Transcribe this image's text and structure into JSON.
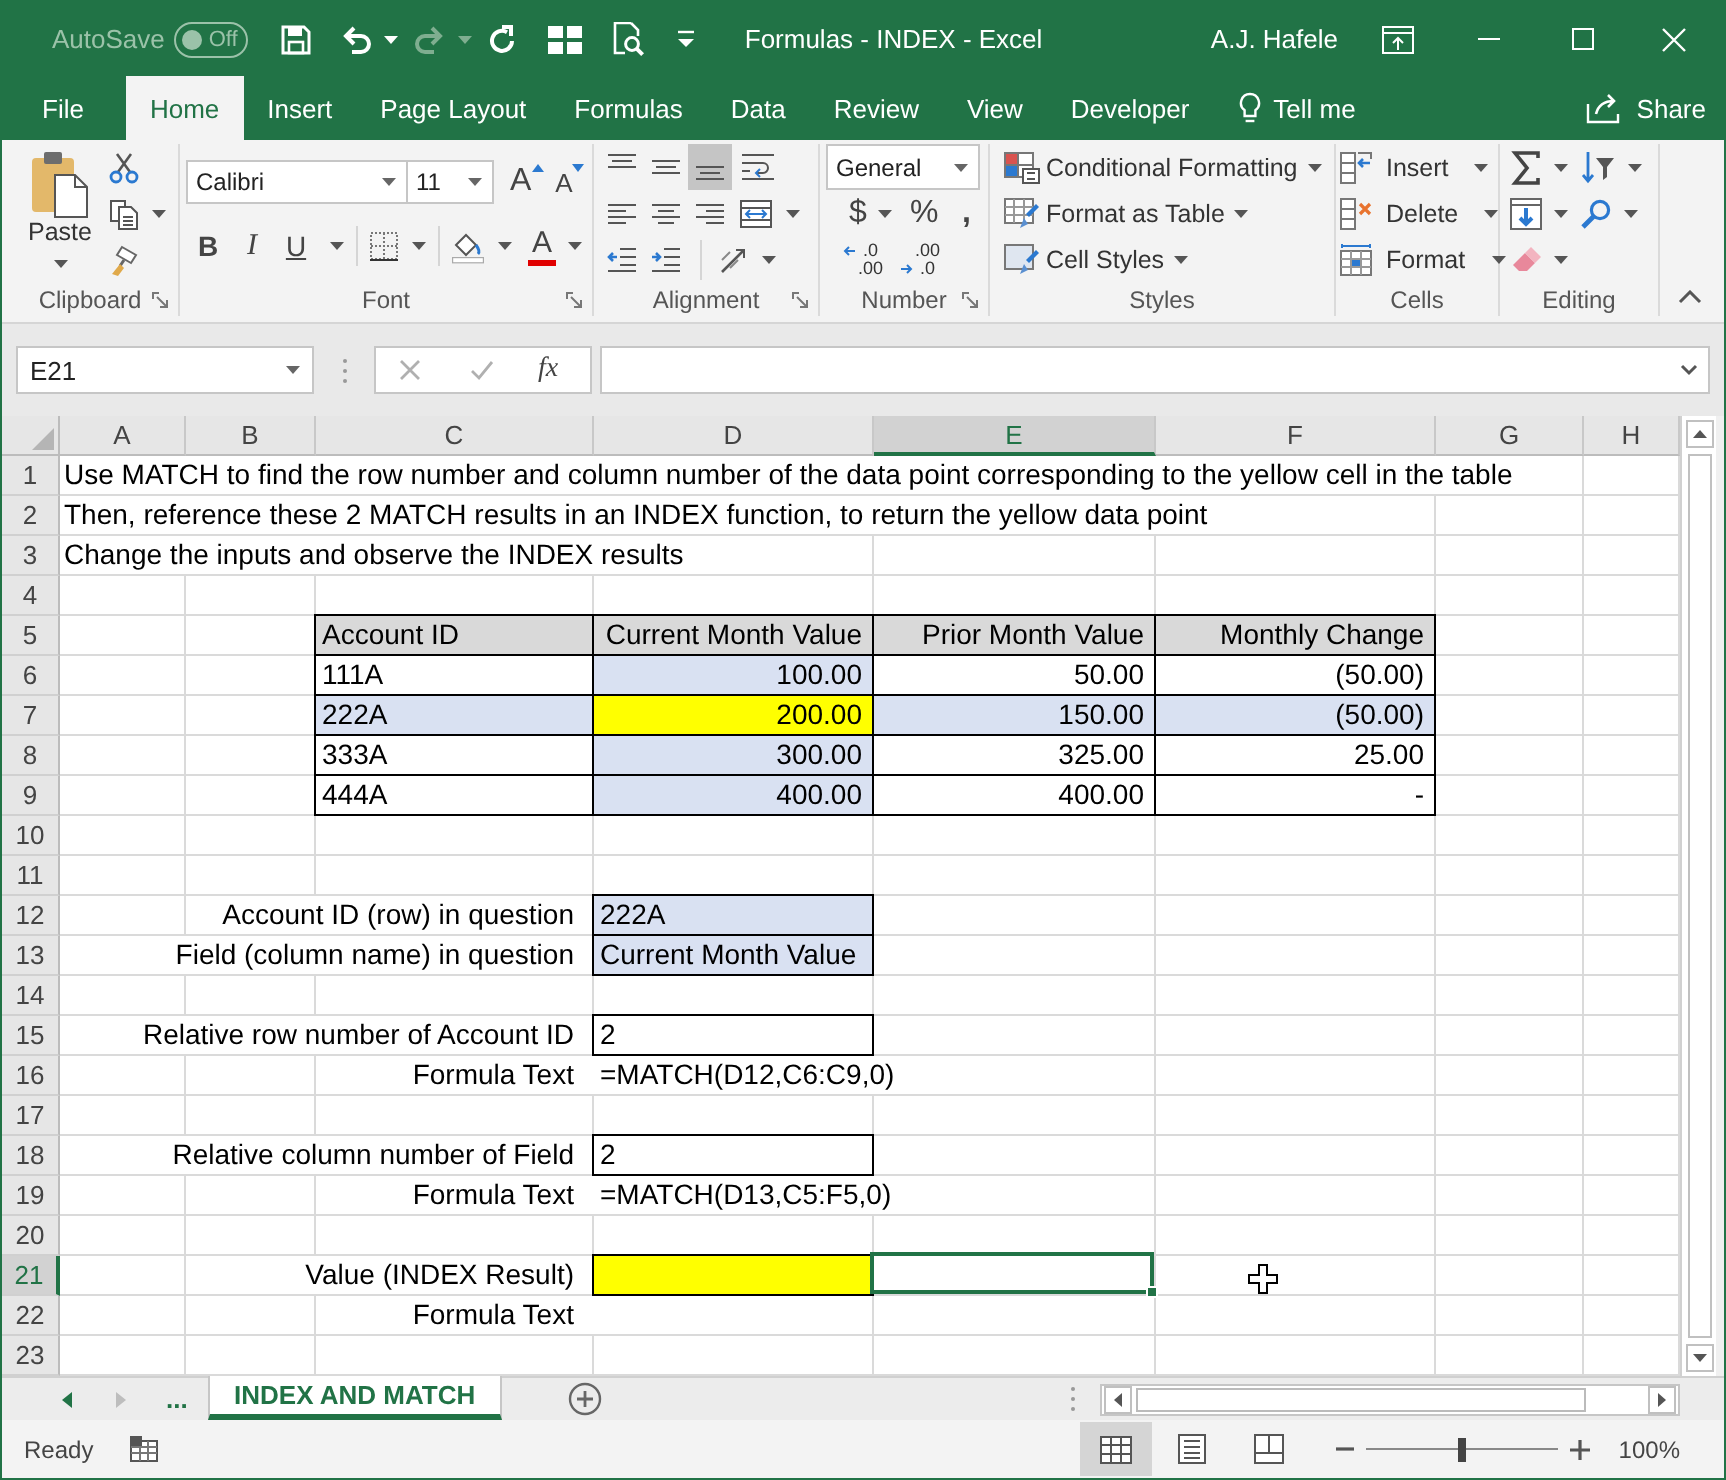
{
  "window": {
    "title": "Formulas - INDEX - Excel",
    "user": "A.J. Hafele",
    "autosave": {
      "label": "AutoSave",
      "on": false,
      "state": "Off"
    },
    "quick_access": [
      {
        "kind": "save",
        "disabled": false
      },
      {
        "kind": "undo",
        "disabled": false
      },
      {
        "kind": "redo",
        "disabled": true
      },
      {
        "kind": "refresh",
        "disabled": false
      },
      {
        "kind": "form",
        "disabled": false
      },
      {
        "kind": "print-preview",
        "disabled": false
      },
      {
        "kind": "customize",
        "disabled": false
      }
    ]
  },
  "menu_tabs": [
    {
      "label": "File",
      "selected": false
    },
    {
      "label": "Home",
      "selected": true
    },
    {
      "label": "Insert",
      "selected": false
    },
    {
      "label": "Page Layout",
      "selected": false
    },
    {
      "label": "Formulas",
      "selected": false
    },
    {
      "label": "Data",
      "selected": false
    },
    {
      "label": "Review",
      "selected": false
    },
    {
      "label": "View",
      "selected": false
    },
    {
      "label": "Developer",
      "selected": false
    }
  ],
  "tell_me": "Tell me",
  "share": "Share",
  "ribbon": {
    "groups": [
      {
        "kind": "clipboard",
        "label": "Clipboard",
        "paste": "Paste"
      },
      {
        "kind": "font",
        "label": "Font",
        "font_name": "Calibri",
        "font_size": "11",
        "grow": "A",
        "shrink": "A",
        "bold": "B",
        "italic": "I",
        "underline": "U",
        "font_color": "A"
      },
      {
        "kind": "alignment",
        "label": "Alignment",
        "vertical": [
          {
            "kind": "top",
            "selected": false
          },
          {
            "kind": "middle",
            "selected": false
          },
          {
            "kind": "bottom",
            "selected": true
          }
        ]
      },
      {
        "kind": "number",
        "label": "Number",
        "format": "General",
        "currency": "$",
        "percent": "%",
        "comma": ",",
        "decimals": [
          {
            "kind": "increase",
            "top": ".0",
            "bottom": ".00"
          },
          {
            "kind": "decrease",
            "top": ".00",
            "bottom": ".0"
          }
        ]
      },
      {
        "kind": "styles",
        "label": "Styles",
        "items": [
          {
            "kind": "conditional",
            "label": "Conditional Formatting"
          },
          {
            "kind": "table",
            "label": "Format as Table"
          },
          {
            "kind": "cell",
            "label": "Cell Styles"
          }
        ]
      },
      {
        "kind": "cells",
        "label": "Cells",
        "items": [
          {
            "kind": "insert",
            "label": "Insert"
          },
          {
            "kind": "delete",
            "label": "Delete"
          },
          {
            "kind": "format",
            "label": "Format"
          }
        ]
      },
      {
        "kind": "editing",
        "label": "Editing"
      }
    ]
  },
  "formula_bar": {
    "name_box": "E21",
    "edit_buttons": [
      {
        "kind": "cancel",
        "disabled": true
      },
      {
        "kind": "enter",
        "disabled": true
      }
    ],
    "insert_function": "fx"
  },
  "sheet": {
    "columns": [
      {
        "label": "A",
        "selected": false
      },
      {
        "label": "B",
        "selected": false
      },
      {
        "label": "C",
        "selected": false
      },
      {
        "label": "D",
        "selected": false
      },
      {
        "label": "E",
        "selected": true
      },
      {
        "label": "F",
        "selected": false
      },
      {
        "label": "G",
        "selected": false
      },
      {
        "label": "H",
        "selected": false
      }
    ],
    "rows": [
      {
        "label": "1",
        "selected": false
      },
      {
        "label": "2",
        "selected": false
      },
      {
        "label": "3",
        "selected": false
      },
      {
        "label": "4",
        "selected": false
      },
      {
        "label": "5",
        "selected": false
      },
      {
        "label": "6",
        "selected": false
      },
      {
        "label": "7",
        "selected": false
      },
      {
        "label": "8",
        "selected": false
      },
      {
        "label": "9",
        "selected": false
      },
      {
        "label": "10",
        "selected": false
      },
      {
        "label": "11",
        "selected": false
      },
      {
        "label": "12",
        "selected": false
      },
      {
        "label": "13",
        "selected": false
      },
      {
        "label": "14",
        "selected": false
      },
      {
        "label": "15",
        "selected": false
      },
      {
        "label": "16",
        "selected": false
      },
      {
        "label": "17",
        "selected": false
      },
      {
        "label": "18",
        "selected": false
      },
      {
        "label": "19",
        "selected": false
      },
      {
        "label": "20",
        "selected": false
      },
      {
        "label": "21",
        "selected": true
      },
      {
        "label": "22",
        "selected": false
      },
      {
        "label": "23",
        "selected": false
      }
    ],
    "instructions": [
      "Use MATCH to find the row number and column number of the data point corresponding to the yellow cell in the table",
      "Then, reference these 2 MATCH results in an INDEX function, to return the yellow data point",
      "Change the inputs and observe the INDEX results"
    ],
    "table": {
      "columns": [
        {
          "label": "Account ID",
          "matched": false
        },
        {
          "label": "Current Month Value",
          "matched": true
        },
        {
          "label": "Prior Month Value",
          "matched": false
        },
        {
          "label": "Monthly Change",
          "matched": false
        }
      ],
      "rows": [
        {
          "matched": false,
          "cells": [
            "111A",
            "100.00",
            "50.00",
            "(50.00)"
          ]
        },
        {
          "matched": true,
          "cells": [
            "222A",
            "200.00",
            "150.00",
            "(50.00)"
          ]
        },
        {
          "matched": false,
          "cells": [
            "333A",
            "300.00",
            "325.00",
            "25.00"
          ]
        },
        {
          "matched": false,
          "cells": [
            "444A",
            "400.00",
            "400.00",
            "-"
          ]
        }
      ]
    },
    "inputs": [
      {
        "label": "Account ID (row) in question",
        "value": "222A"
      },
      {
        "label": "Field (column name) in question",
        "value": "Current Month Value"
      }
    ],
    "lookups": [
      {
        "label": "Relative row number of Account ID",
        "value": "2",
        "formula_label": "Formula Text",
        "formula": "=MATCH(D12,C6:C9,0)"
      },
      {
        "label": "Relative column number of Field",
        "value": "2",
        "formula_label": "Formula Text",
        "formula": "=MATCH(D13,C5:F5,0)"
      }
    ],
    "result": {
      "label": "Value (INDEX Result)",
      "highlighted": true,
      "formula_label": "Formula Text"
    }
  },
  "sheet_tabs": {
    "more": "...",
    "tabs": [
      {
        "label": "INDEX AND MATCH",
        "selected": true
      }
    ]
  },
  "status_bar": {
    "status": "Ready",
    "views": [
      {
        "kind": "normal",
        "selected": true
      },
      {
        "kind": "page-layout",
        "selected": false
      },
      {
        "kind": "page-break",
        "selected": false
      }
    ],
    "zoom": {
      "level": 0.5,
      "label": "100%"
    }
  }
}
